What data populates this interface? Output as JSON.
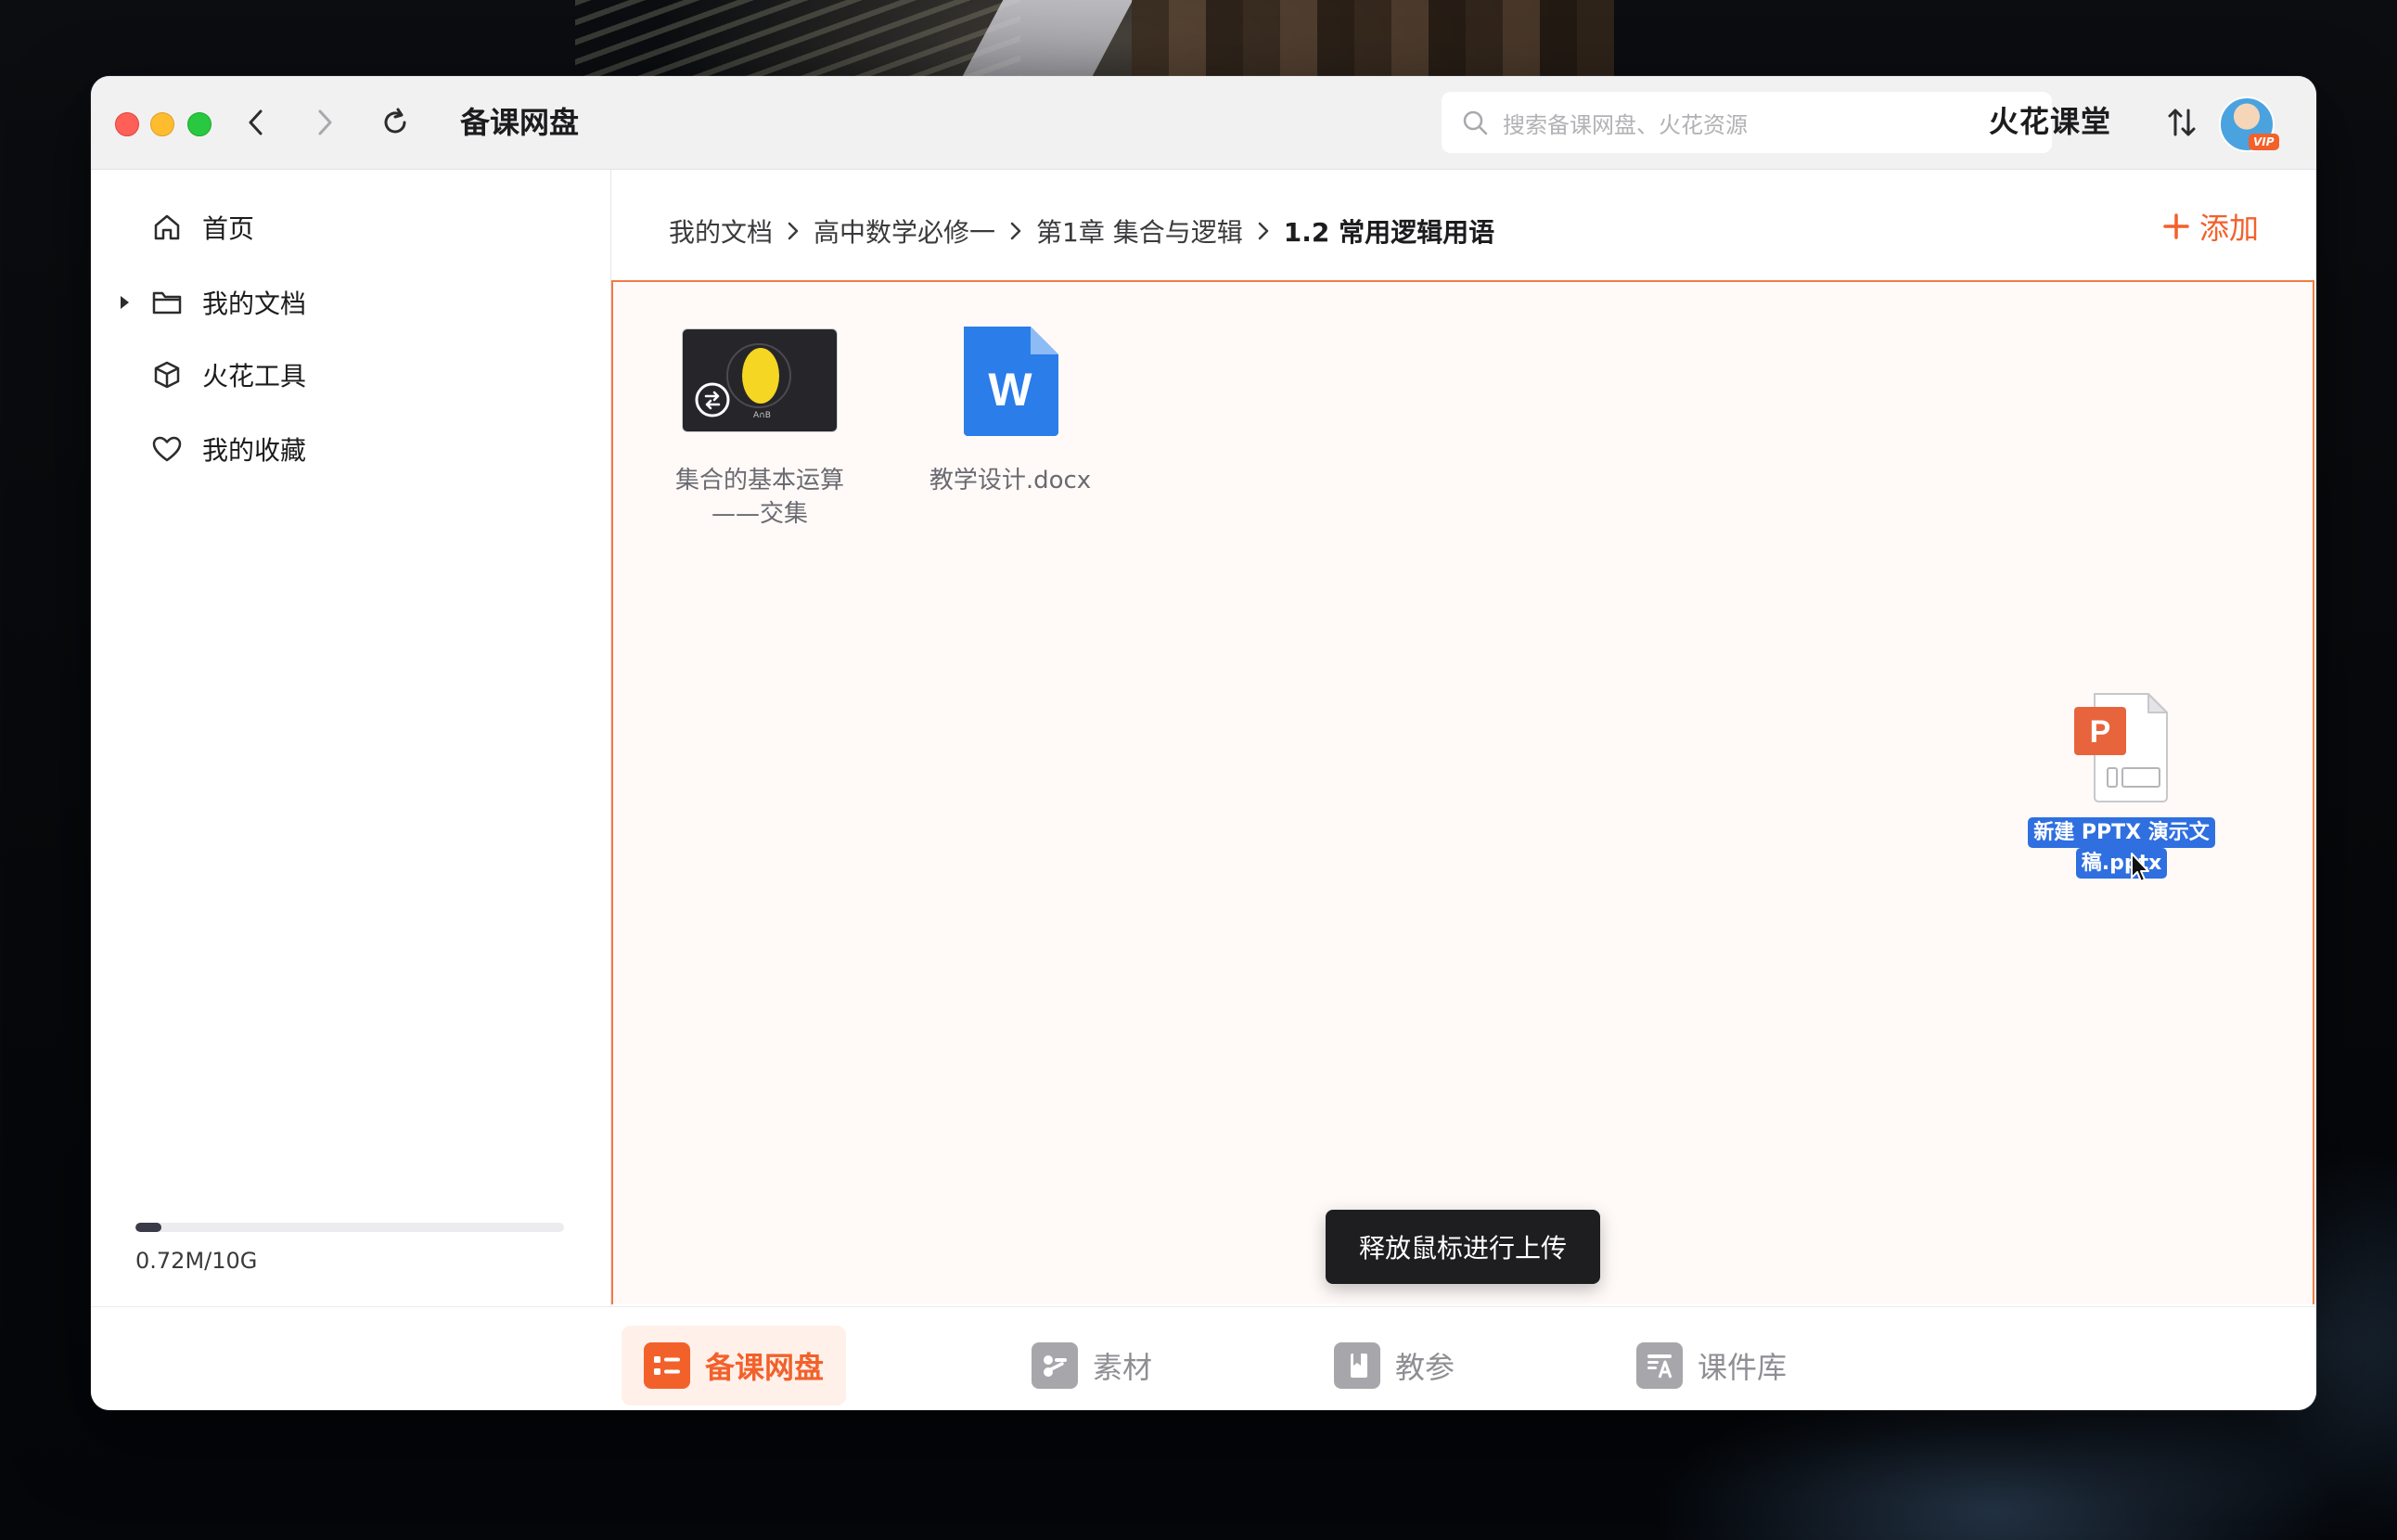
{
  "window": {
    "title": "备课网盘",
    "brand": "火花课堂",
    "vip_badge": "VIP"
  },
  "search": {
    "placeholder": "搜索备课网盘、火花资源"
  },
  "sidebar": {
    "items": [
      {
        "label": "首页",
        "icon": "home-icon"
      },
      {
        "label": "我的文档",
        "icon": "folder-icon",
        "expandable": true
      },
      {
        "label": "火花工具",
        "icon": "cube-icon"
      },
      {
        "label": "我的收藏",
        "icon": "heart-icon"
      }
    ],
    "storage": {
      "text": "0.72M/10G",
      "used_fraction": 0.06
    }
  },
  "breadcrumb": {
    "items": [
      "我的文档",
      "高中数学必修一",
      "第1章 集合与逻辑",
      "1.2 常用逻辑用语"
    ]
  },
  "toolbar": {
    "add_label": "添加"
  },
  "files": [
    {
      "name": "集合的基本运算——交集",
      "type": "video",
      "thumb_caption": "A∩B"
    },
    {
      "name": "教学设计.docx",
      "type": "docx",
      "icon_letter": "W"
    }
  ],
  "drag": {
    "file_name_line1": "新建 PPTX 演示文",
    "file_name_line2": "稿.pptx",
    "icon_letter": "P"
  },
  "toast": {
    "text": "释放鼠标进行上传"
  },
  "bottom_tabs": [
    {
      "label": "备课网盘",
      "active": true
    },
    {
      "label": "素材",
      "active": false
    },
    {
      "label": "教参",
      "active": false
    },
    {
      "label": "课件库",
      "active": false
    }
  ],
  "colors": {
    "accent": "#f2612a",
    "drop_border": "#f07c46",
    "word_blue": "#2b7de9",
    "ppt_orange": "#e8643c",
    "selection_blue": "#2f6fe0"
  }
}
